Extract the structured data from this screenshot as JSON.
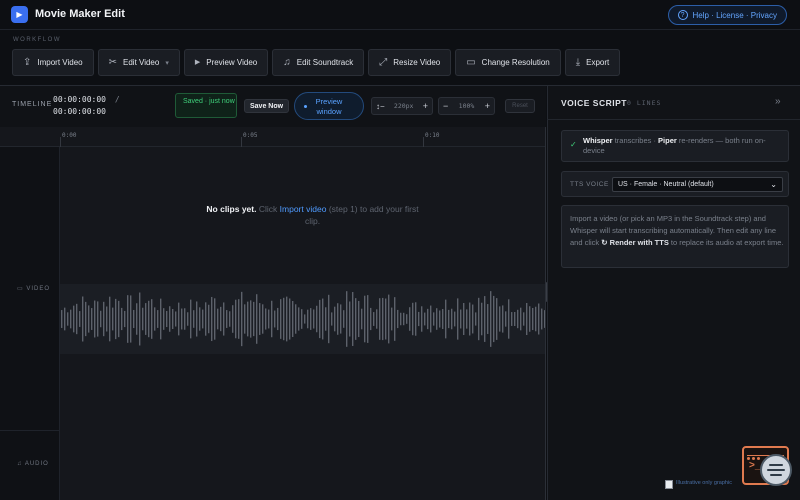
{
  "header": {
    "app_title": "Movie Maker Edit",
    "help_link": "Help · License · Privacy"
  },
  "workflow": {
    "label": "WORKFLOW",
    "buttons": [
      {
        "label": "Import Video",
        "icon": "upload-icon"
      },
      {
        "label": "Edit Video",
        "icon": "scissors-icon",
        "has_dropdown": true
      },
      {
        "label": "Preview Video",
        "icon": "play-icon"
      },
      {
        "label": "Edit Soundtrack",
        "icon": "music-note-icon"
      },
      {
        "label": "Resize Video",
        "icon": "resize-icon"
      },
      {
        "label": "Change Resolution",
        "icon": "monitor-icon"
      },
      {
        "label": "Export",
        "icon": "download-icon"
      }
    ]
  },
  "timeline": {
    "label": "TIMELINE",
    "current_time": "00:00:00:00",
    "separator": "/",
    "total_time": "00:00:00:00",
    "saved_status": "Saved · just now",
    "save_now": "Save Now",
    "preview_window": "Preview window",
    "zoom_px": "220px",
    "zoom_pct": "100%",
    "reset": "Reset",
    "ruler_marks": [
      "0:00",
      "0:05",
      "0:10"
    ],
    "empty_bold": "No clips yet.",
    "empty_pre": "Click",
    "empty_link": "Import video",
    "empty_post": "(step 1) to add your first clip.",
    "track_video": "VIDEO",
    "track_audio": "AUDIO"
  },
  "voice_script": {
    "title": "VOICE SCRIPT",
    "count": "0 LINES",
    "collapse": "»",
    "engine_whisper": "Whisper",
    "engine_mid": "transcribes ·",
    "engine_piper": "Piper",
    "engine_post": "re-renders — both run on-device",
    "tts_label": "TTS VOICE",
    "tts_selected": "US · Female · Neutral (default)",
    "help_pre": "Import a video (or pick an MP3 in the Soundtrack step) and Whisper will start transcribing automatically. Then edit any line and click",
    "help_action": "↻ Render with TTS",
    "help_post": "to replace its audio at export time."
  },
  "footer": {
    "broken_image_alt": "Illustrative only graphic"
  },
  "colors": {
    "accent": "#3a6ff0",
    "link": "#4f9bff",
    "success": "#3fcf7a",
    "widget_orange": "#e07a4f"
  }
}
